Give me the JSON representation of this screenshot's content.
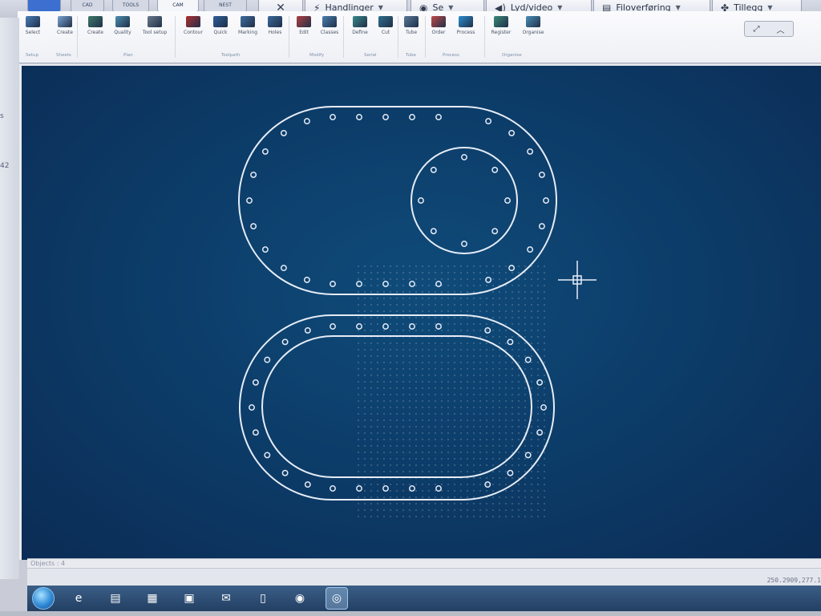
{
  "app_tabs": [
    {
      "label": "",
      "active": false
    },
    {
      "label": "CAD",
      "active": false
    },
    {
      "label": "TOOLS",
      "active": false
    },
    {
      "label": "CAM",
      "active": true
    },
    {
      "label": "NEST",
      "active": false
    }
  ],
  "menus": [
    {
      "label": "",
      "icon": "close-x-icon"
    },
    {
      "label": "Handlinger",
      "icon": "lightning-icon"
    },
    {
      "label": "Se",
      "icon": "eye-icon"
    },
    {
      "label": "Lyd/video",
      "icon": "speaker-icon"
    },
    {
      "label": "Filoverføring",
      "icon": "file-transfer-icon"
    },
    {
      "label": "Tillegg",
      "icon": "puzzle-icon"
    }
  ],
  "ribbon": {
    "tools": [
      {
        "label": "Select",
        "color": "#4a7fb8"
      },
      {
        "label": "Create",
        "color": "#7aa4d4"
      },
      {
        "label": "Create",
        "color": "#3d7a6a"
      },
      {
        "label": "Quality",
        "color": "#4b8fb0"
      },
      {
        "label": "Tool setup",
        "color": "#6a7a8c"
      },
      {
        "label": "Contour",
        "color": "#b03030"
      },
      {
        "label": "Quick",
        "color": "#2f5f9a"
      },
      {
        "label": "Marking",
        "color": "#3f6f9f"
      },
      {
        "label": "Holes",
        "color": "#3a6a9a"
      },
      {
        "label": "Edit",
        "color": "#b04040"
      },
      {
        "label": "Classes",
        "color": "#4a80b0"
      },
      {
        "label": "Define",
        "color": "#3a8a8a"
      },
      {
        "label": "Cut",
        "color": "#2e6f8e"
      },
      {
        "label": "Tube",
        "color": "#5a7a9a"
      },
      {
        "label": "Order",
        "color": "#c04a4a"
      },
      {
        "label": "Process",
        "color": "#2b8ed0"
      },
      {
        "label": "Register",
        "color": "#3d8a7a"
      },
      {
        "label": "Organise",
        "color": "#4a90b8"
      }
    ],
    "groups": [
      {
        "label": "Setup"
      },
      {
        "label": "Sheets"
      },
      {
        "label": "Plan"
      },
      {
        "label": "Toolpath"
      },
      {
        "label": "Modify"
      },
      {
        "label": "Serial"
      },
      {
        "label": "Tube"
      },
      {
        "label": "Process"
      },
      {
        "label": "Organise"
      }
    ]
  },
  "left_fragments": [
    "s",
    "42"
  ],
  "command": {
    "text": "Objects : 4"
  },
  "status": {
    "coords": "250.2909,277.1"
  },
  "taskbar": {
    "items": [
      {
        "icon": "internet-explorer-icon",
        "glyph": "e",
        "active": false
      },
      {
        "icon": "folder-icon",
        "glyph": "▤",
        "active": false
      },
      {
        "icon": "app-window-icon",
        "glyph": "▦",
        "active": false
      },
      {
        "icon": "cad-app-icon",
        "glyph": "▣",
        "active": false
      },
      {
        "icon": "mail-icon",
        "glyph": "✉",
        "active": false
      },
      {
        "icon": "usb-drive-icon",
        "glyph": "▯",
        "active": false
      },
      {
        "icon": "chrome-icon",
        "glyph": "◉",
        "active": false
      },
      {
        "icon": "remote-desktop-icon",
        "glyph": "◎",
        "active": true
      }
    ]
  },
  "colors": {
    "canvas_bg": "#0c3a66",
    "geometry": "#e6ecf6",
    "grid_dots": "#c8d4e4",
    "taskbar": "#2b4a70"
  }
}
